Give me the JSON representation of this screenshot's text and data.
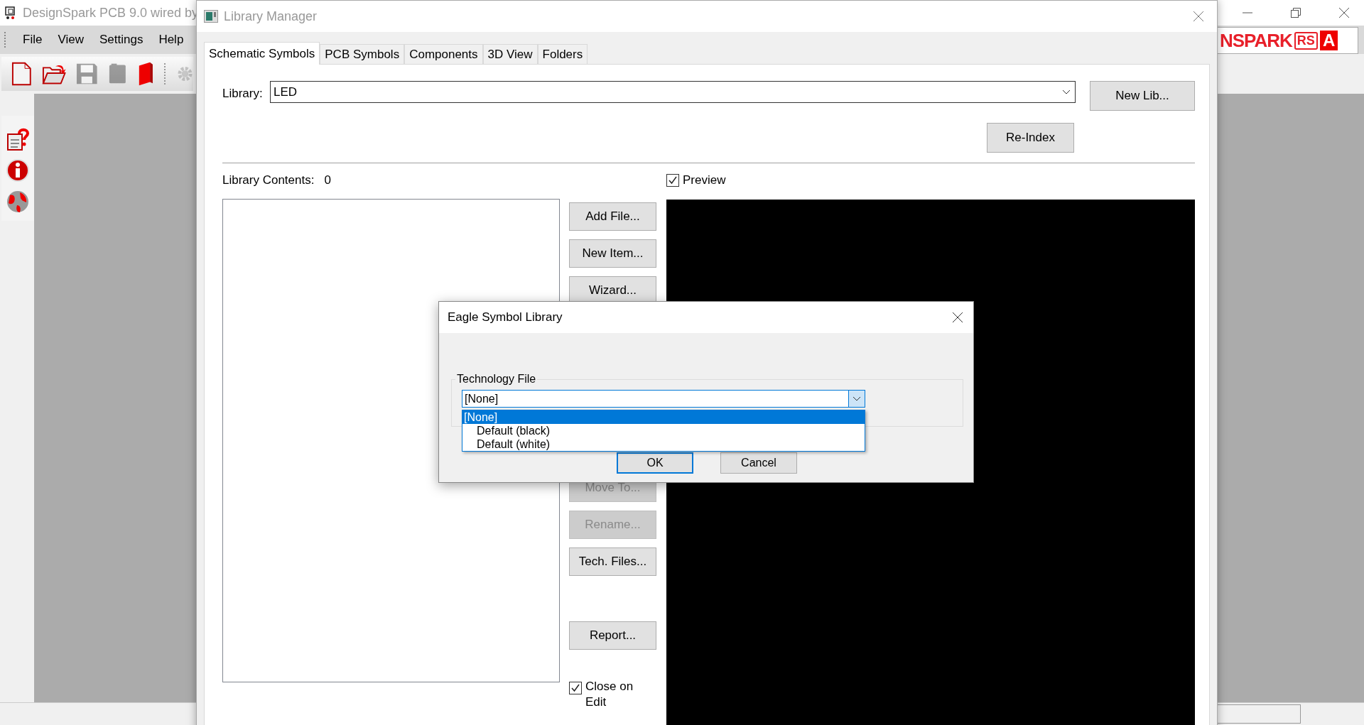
{
  "app": {
    "title": "DesignSpark PCB 9.0 wired by",
    "menu": [
      "File",
      "View",
      "Settings",
      "Help"
    ],
    "toolbar": [
      {
        "kind": "new-file",
        "disabled": false
      },
      {
        "kind": "open-folder",
        "disabled": false
      },
      {
        "kind": "save",
        "disabled": true
      },
      {
        "kind": "binder",
        "disabled": true
      },
      {
        "kind": "book",
        "disabled": false
      }
    ],
    "side_toolbar": [
      {
        "kind": "help-doc"
      },
      {
        "kind": "info"
      },
      {
        "kind": "globe"
      }
    ],
    "logo": {
      "wordmark": "NSPARK",
      "badge": "RS",
      "mark": "A"
    }
  },
  "library_manager": {
    "title": "Library Manager",
    "tabs": [
      {
        "label": "Schematic Symbols",
        "selected": true
      },
      {
        "label": "PCB Symbols",
        "selected": false
      },
      {
        "label": "Components",
        "selected": false
      },
      {
        "label": "3D View",
        "selected": false
      },
      {
        "label": "Folders",
        "selected": false
      }
    ],
    "library_label": "Library:",
    "library_value": "LED",
    "new_lib_button": "New Lib...",
    "reindex_button": "Re-Index",
    "contents_label": "Library Contents:",
    "contents_count": "0",
    "preview": {
      "label": "Preview",
      "checked": true
    },
    "buttons": [
      {
        "label": "Add File...",
        "disabled": false
      },
      {
        "label": "New Item...",
        "disabled": false
      },
      {
        "label": "Wizard...",
        "disabled": false
      },
      {
        "label": "Move To...",
        "disabled": true
      },
      {
        "label": "Rename...",
        "disabled": true
      },
      {
        "label": "Tech. Files...",
        "disabled": false
      },
      {
        "label": "Report...",
        "disabled": false
      }
    ],
    "close_on_edit": {
      "label": "Close on Edit",
      "checked": true
    }
  },
  "dialog": {
    "title": "Eagle Symbol Library",
    "group_label": "Technology File",
    "combo_value": "[None]",
    "options": [
      {
        "label": "[None]",
        "selected": true
      },
      {
        "label": "Default (black)",
        "selected": false
      },
      {
        "label": "Default (white)",
        "selected": false
      }
    ],
    "buttons": [
      {
        "label": "OK",
        "default": true
      },
      {
        "label": "Cancel",
        "default": false
      }
    ]
  }
}
